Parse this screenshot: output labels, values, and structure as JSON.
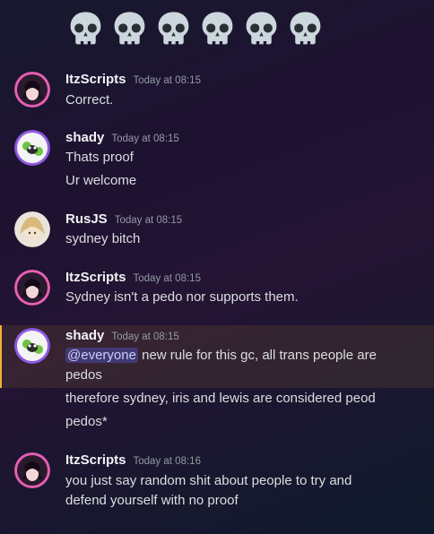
{
  "reaction_emoji": {
    "icon": "skull-icon",
    "count": 6
  },
  "messages": [
    {
      "username": "ItzScripts",
      "timestamp": "Today at 08:15",
      "avatar": "itzscripts-avatar",
      "lines": [
        "Correct."
      ]
    },
    {
      "username": "shady",
      "timestamp": "Today at 08:15",
      "avatar": "shady-avatar",
      "lines": [
        "Thats proof",
        "Ur welcome"
      ]
    },
    {
      "username": "RusJS",
      "timestamp": "Today at 08:15",
      "avatar": "rusjs-avatar",
      "lines": [
        "sydney bitch"
      ]
    },
    {
      "username": "ItzScripts",
      "timestamp": "Today at 08:15",
      "avatar": "itzscripts-avatar",
      "lines": [
        "Sydney isn't a pedo nor supports them."
      ]
    },
    {
      "username": "shady",
      "timestamp": "Today at 08:15",
      "avatar": "shady-avatar",
      "highlighted": true,
      "mention": "@everyone",
      "line1_rest": " new rule for this gc, all trans people are",
      "line2": "pedos",
      "line3": "therefore sydney, iris and lewis are considered peod",
      "line4": "pedos*"
    },
    {
      "username": "ItzScripts",
      "timestamp": "Today at 08:16",
      "avatar": "itzscripts-avatar",
      "lines": [
        "you just say random shit about people to try and",
        "defend yourself with no proof"
      ]
    }
  ],
  "colors": {
    "highlight_bar": "#f0b132",
    "mention_bg": "#5865f2"
  }
}
